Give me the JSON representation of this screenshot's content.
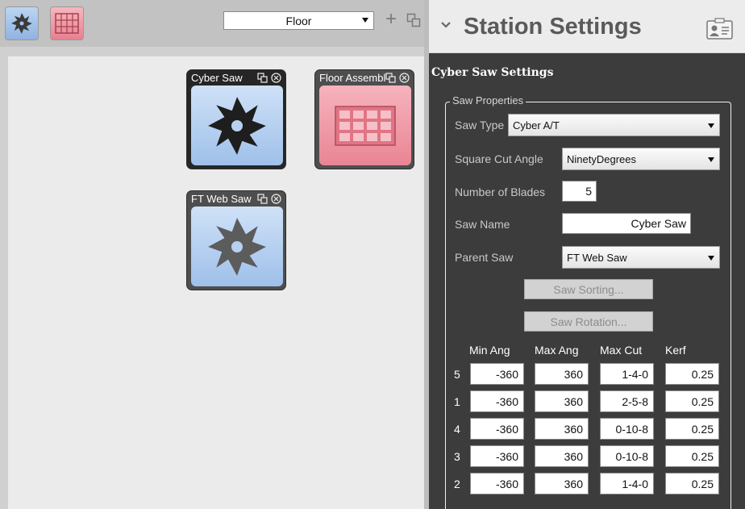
{
  "toolbar": {
    "saw_icon": "saw-blade-icon",
    "grid_icon": "grid-icon",
    "floor_select_value": "Floor",
    "add_icon": "plus-icon",
    "restore_icon": "restore-window-icon"
  },
  "tiles": [
    {
      "title": "Cyber Saw",
      "icon": "saw-blade-icon",
      "style": "blue",
      "selected": true
    },
    {
      "title": "Floor Assembly",
      "icon": "grid-icon",
      "style": "pink",
      "selected": false
    },
    {
      "title": "FT Web Saw",
      "icon": "saw-blade-icon",
      "style": "blue",
      "selected": false
    }
  ],
  "panel": {
    "title": "Station Settings",
    "section_title": "Cyber Saw Settings",
    "group_title": "Saw Properties",
    "fields": {
      "saw_type_label": "Saw Type",
      "saw_type_value": "Cyber A/T",
      "square_cut_angle_label": "Square Cut Angle",
      "square_cut_angle_value": "NinetyDegrees",
      "number_of_blades_label": "Number of Blades",
      "number_of_blades_value": "5",
      "saw_name_label": "Saw Name",
      "saw_name_value": "Cyber Saw",
      "parent_saw_label": "Parent Saw",
      "parent_saw_value": "FT Web Saw"
    },
    "buttons": {
      "saw_sorting": "Saw Sorting...",
      "saw_rotation": "Saw Rotation..."
    },
    "blade_table": {
      "columns": [
        "Min Ang",
        "Max Ang",
        "Max Cut",
        "Kerf"
      ],
      "rows": [
        {
          "blade": "5",
          "min_ang": "-360",
          "max_ang": "360",
          "max_cut": "1-4-0",
          "kerf": "0.25"
        },
        {
          "blade": "1",
          "min_ang": "-360",
          "max_ang": "360",
          "max_cut": "2-5-8",
          "kerf": "0.25"
        },
        {
          "blade": "4",
          "min_ang": "-360",
          "max_ang": "360",
          "max_cut": "0-10-8",
          "kerf": "0.25"
        },
        {
          "blade": "3",
          "min_ang": "-360",
          "max_ang": "360",
          "max_cut": "0-10-8",
          "kerf": "0.25"
        },
        {
          "blade": "2",
          "min_ang": "-360",
          "max_ang": "360",
          "max_cut": "1-4-0",
          "kerf": "0.25"
        }
      ]
    }
  },
  "colors": {
    "panel_bg": "#3c3c3c",
    "tile_blue": "#9fc0ea",
    "tile_pink": "#e98594"
  }
}
